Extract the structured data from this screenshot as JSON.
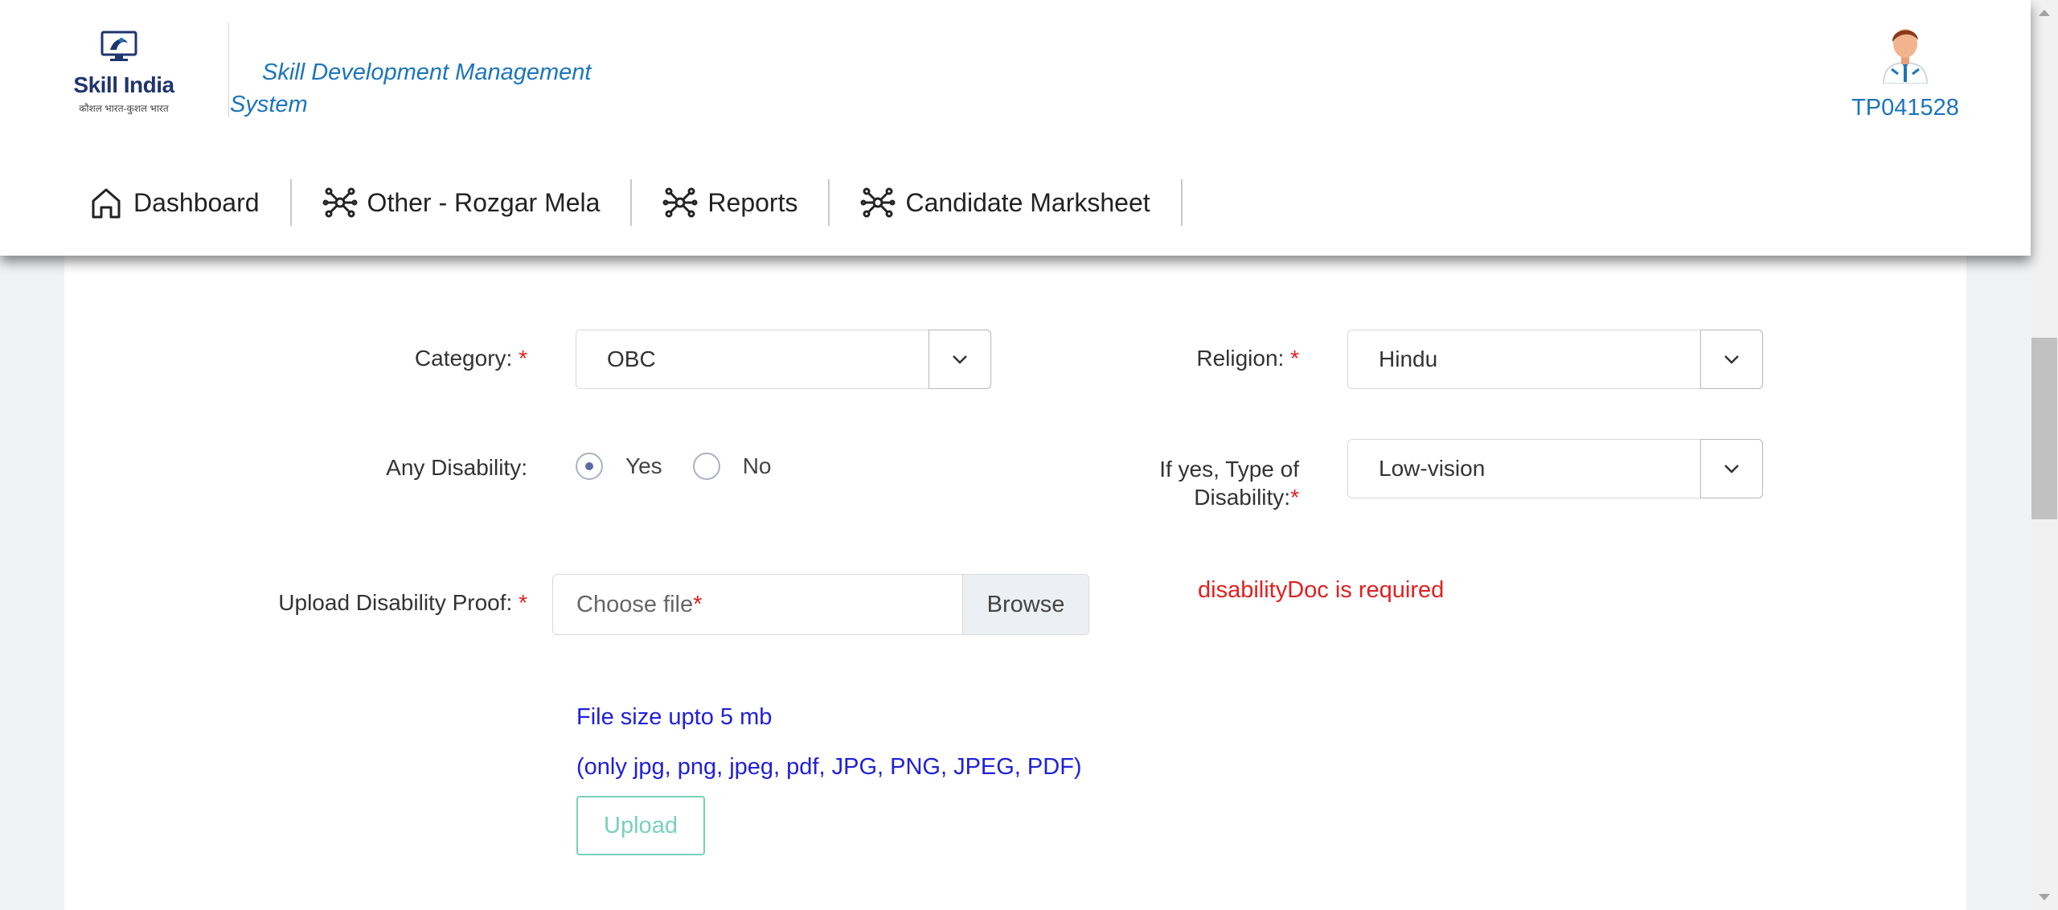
{
  "header": {
    "logo_text": "Skill India",
    "logo_sub": "कौशल भारत-कुशल भारत",
    "app_title": "Skill Development Management System",
    "user_id": "TP041528"
  },
  "nav": {
    "items": [
      {
        "label": "Dashboard",
        "icon": "home-icon"
      },
      {
        "label": "Other - Rozgar Mela",
        "icon": "network-icon"
      },
      {
        "label": "Reports",
        "icon": "network-icon"
      },
      {
        "label": "Candidate Marksheet",
        "icon": "network-icon"
      }
    ]
  },
  "form": {
    "category": {
      "label": "Category:",
      "required": "*",
      "value": "OBC"
    },
    "religion": {
      "label": "Religion:",
      "required": "*",
      "value": "Hindu"
    },
    "disability": {
      "label": "Any Disability:",
      "options": [
        {
          "label": "Yes",
          "checked": true
        },
        {
          "label": "No",
          "checked": false
        }
      ]
    },
    "disability_type": {
      "label_line1": "If yes, Type of",
      "label_line2": "Disability:",
      "required": "*",
      "value": "Low-vision"
    },
    "upload": {
      "label": "Upload Disability Proof:",
      "required": "*",
      "placeholder": "Choose file",
      "placeholder_required": "*",
      "browse_label": "Browse",
      "error": "disabilityDoc is required",
      "hint_size": "File size upto 5 mb",
      "hint_types": "(only jpg, png, jpeg, pdf, JPG, PNG, JPEG, PDF)",
      "upload_label": "Upload"
    }
  },
  "colors": {
    "accent": "#1b75bb",
    "error": "#e02020",
    "hint": "#2020d8",
    "upload_button": "#79d0bc"
  }
}
